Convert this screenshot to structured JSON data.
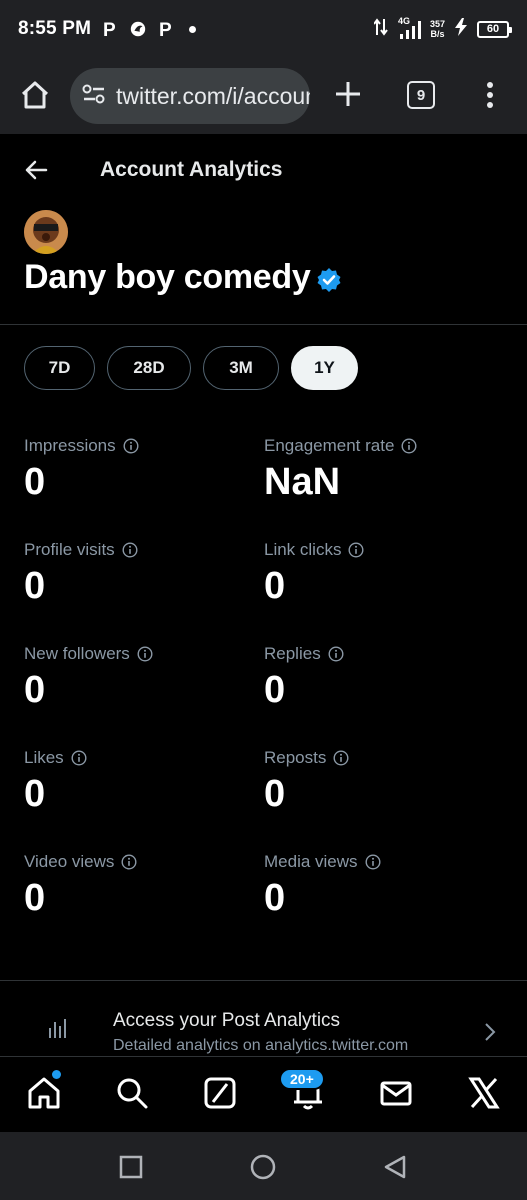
{
  "status_bar": {
    "time": "8:55 PM",
    "app_icons": [
      "P",
      "P"
    ],
    "network": "4G",
    "speed_value": "357",
    "speed_unit": "B/s",
    "battery": "60"
  },
  "browser": {
    "url": "twitter.com/i/account_analytics",
    "tab_count": "9"
  },
  "header": {
    "title": "Account Analytics"
  },
  "account": {
    "name": "Dany boy comedy"
  },
  "periods": [
    {
      "label": "7D",
      "active": false
    },
    {
      "label": "28D",
      "active": false
    },
    {
      "label": "3M",
      "active": false
    },
    {
      "label": "1Y",
      "active": true
    }
  ],
  "metrics": [
    {
      "label": "Impressions",
      "value": "0"
    },
    {
      "label": "Engagement rate",
      "value": "NaN"
    },
    {
      "label": "Profile visits",
      "value": "0"
    },
    {
      "label": "Link clicks",
      "value": "0"
    },
    {
      "label": "New followers",
      "value": "0"
    },
    {
      "label": "Replies",
      "value": "0"
    },
    {
      "label": "Likes",
      "value": "0"
    },
    {
      "label": "Reposts",
      "value": "0"
    },
    {
      "label": "Video views",
      "value": "0"
    },
    {
      "label": "Media views",
      "value": "0"
    }
  ],
  "post_analytics": {
    "title": "Access your Post Analytics",
    "subtitle": "Detailed analytics on analytics.twitter.com"
  },
  "bottom_nav": {
    "notifications_badge": "20+",
    "items": [
      "home-icon",
      "search-icon",
      "grok-icon",
      "bell-icon",
      "mail-icon",
      "x-logo-icon"
    ]
  },
  "colors": {
    "accent": "#1d9bf0",
    "background": "#000000",
    "secondary_text": "#8b98a5"
  }
}
